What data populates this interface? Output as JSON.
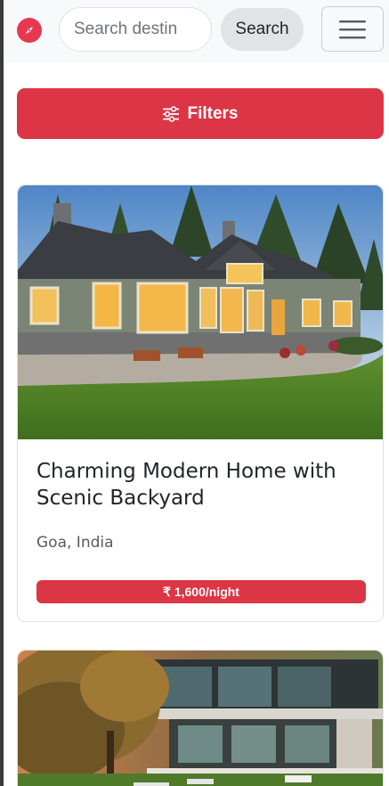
{
  "navbar": {
    "brand_icon": "compass-icon",
    "search_placeholder": "Search destin",
    "search_button_label": "Search",
    "menu_icon": "hamburger-menu-icon"
  },
  "filters": {
    "label": "Filters",
    "icon": "sliders-icon"
  },
  "listings": [
    {
      "image": "house-exterior-photo",
      "title": "Charming Modern Home with Scenic Backyard",
      "location": "Goa, India",
      "price": "₹ 1,600/night"
    },
    {
      "image": "modern-villa-photo"
    }
  ],
  "colors": {
    "accent": "#dc3545",
    "navbar_bg": "#f8f9fa",
    "search_button_bg": "#e2e3e5"
  }
}
